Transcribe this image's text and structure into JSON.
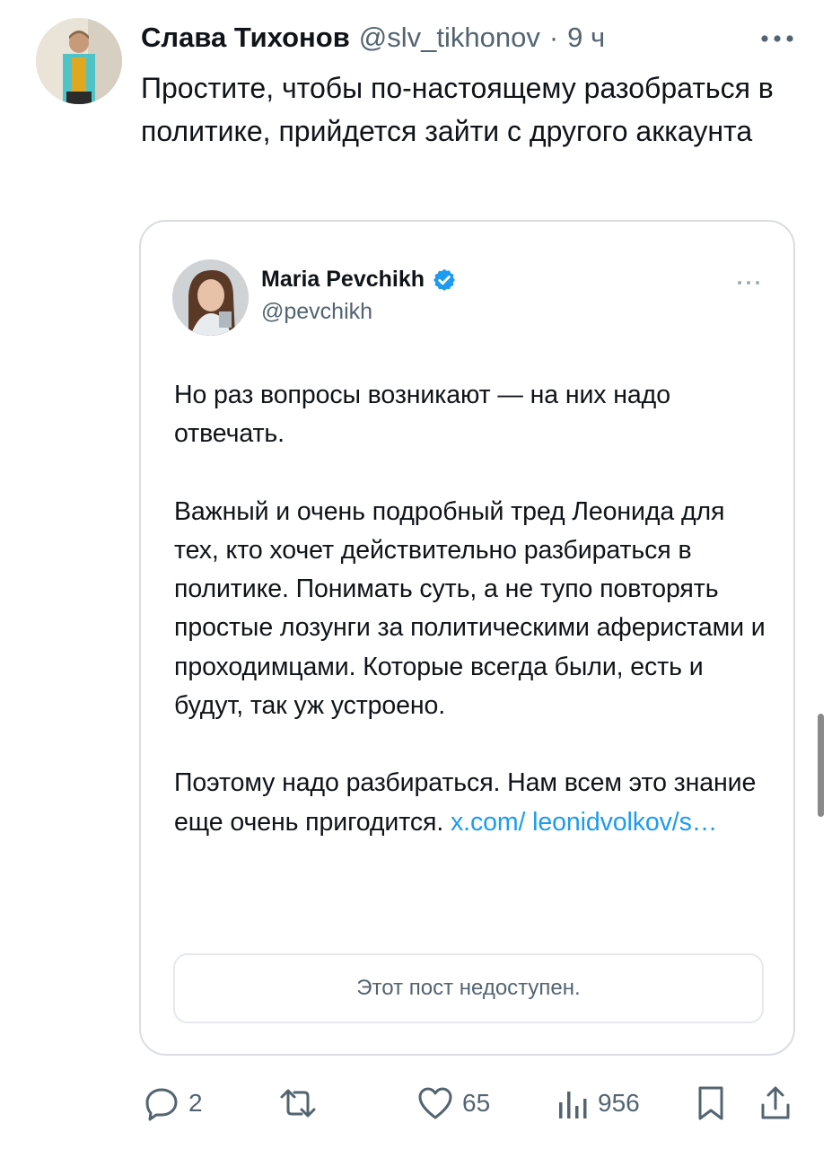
{
  "tweet": {
    "author_name": "Слава Тихонов",
    "author_handle": "@slv_tikhonov",
    "separator": "·",
    "time": "9 ч",
    "text": "Простите, чтобы по-настоящему разобраться в политике, прийдется зайти с другого аккаунта"
  },
  "quote": {
    "author_name": "Maria Pevchikh",
    "author_handle": "@pevchikh",
    "verified_color": "#1d9bf0",
    "paragraph_1": "Но раз вопросы возникают — на них надо отвечать.",
    "paragraph_2": "Важный и очень подробный тред Леонида для тех, кто хочет действительно разбираться в политике. Понимать суть, а не тупо повторять простые лозунги за политическими аферистами и проходимцами. Которые всегда были, есть и будут, так уж устроено.",
    "paragraph_3": "Поэтому надо разбираться. Нам всем это знание еще очень пригодится.",
    "link_text": "x.com/ leonidvolkov/s…",
    "unavailable_text": "Этот пост недоступен."
  },
  "actions": {
    "replies": "2",
    "retweets": "",
    "likes": "65",
    "views": "956",
    "icons": [
      "reply-icon",
      "retweet-icon",
      "like-icon",
      "views-icon",
      "bookmark-icon",
      "share-icon"
    ]
  },
  "colors": {
    "text": "#0f1419",
    "secondary": "#536471",
    "link": "#1d9bf0",
    "border": "#d9dde1"
  }
}
